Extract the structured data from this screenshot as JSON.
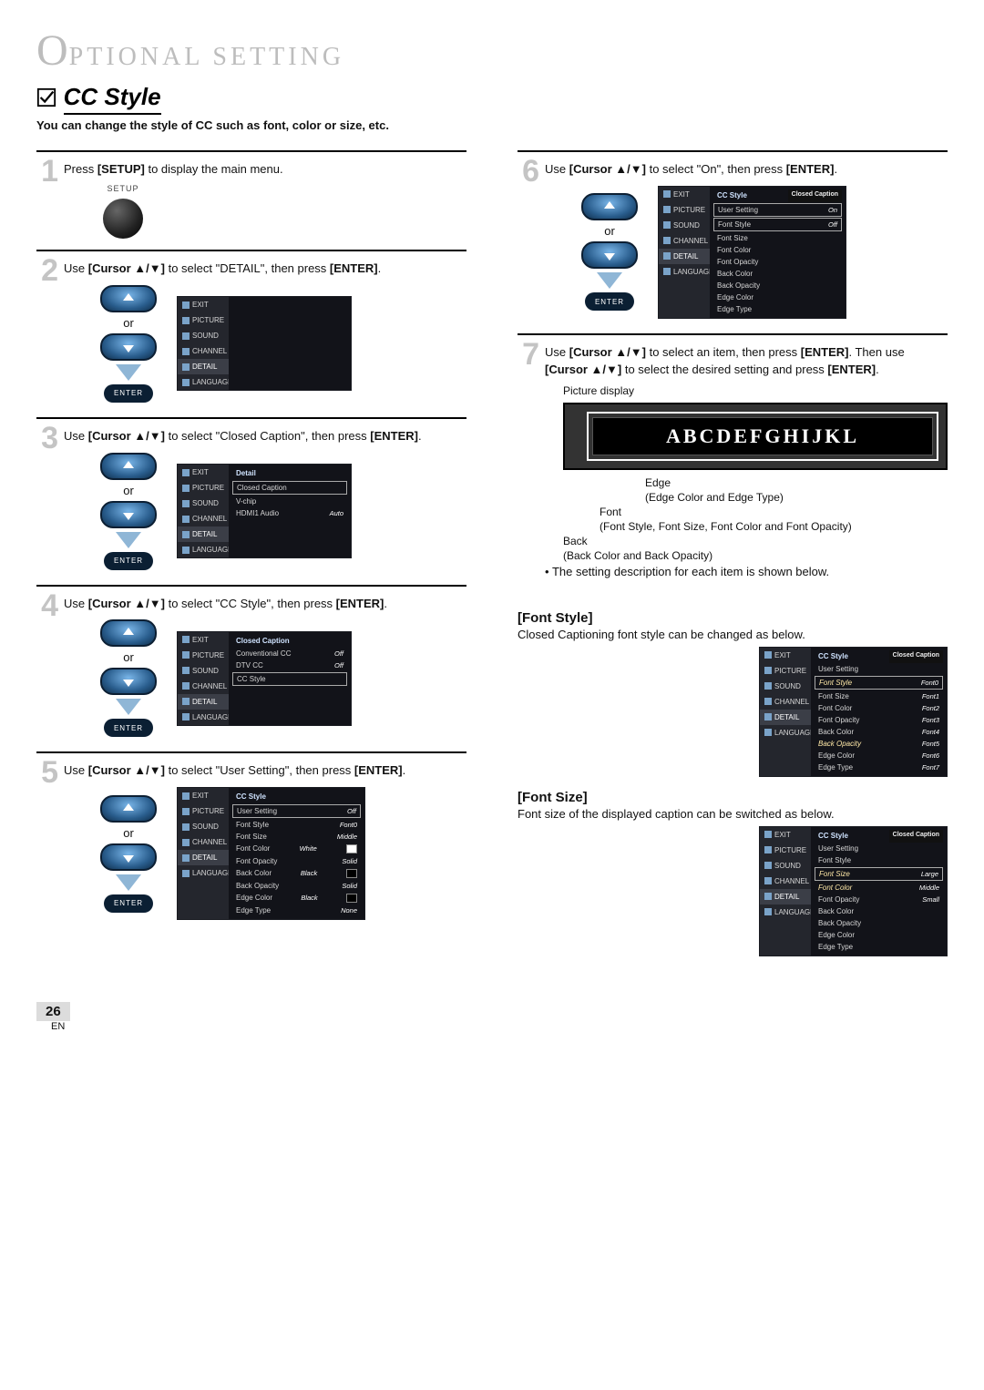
{
  "mast": {
    "o": "O",
    "rest": "PTIONAL  SETTING"
  },
  "section": {
    "title": "CC Style",
    "intro": "You can change the style of CC such as font, color or size, etc."
  },
  "labels": {
    "or": "or",
    "enter": "ENTER",
    "setup": "SETUP",
    "arrows": "▲ / ▼"
  },
  "osdSide": [
    "EXIT",
    "PICTURE",
    "SOUND",
    "CHANNEL",
    "DETAIL",
    "LANGUAGE"
  ],
  "steps": {
    "s1": {
      "n": "1",
      "text_a": "Press ",
      "key": "[SETUP]",
      "text_b": " to display the main menu."
    },
    "s2": {
      "n": "2",
      "text_a": "Use ",
      "key1": "[Cursor ▲/▼]",
      "text_b": " to select \"DETAIL\", then press ",
      "key2": "[ENTER]",
      "text_c": "."
    },
    "s3": {
      "n": "3",
      "text_a": "Use ",
      "key1": "[Cursor ▲/▼]",
      "text_b": " to select \"Closed Caption\", then press ",
      "key2": "[ENTER]",
      "text_c": ".",
      "osd": {
        "title": "Detail",
        "rows": [
          {
            "l": "Closed Caption",
            "boxed": true
          },
          {
            "l": "V-chip"
          },
          {
            "l": "HDMI1 Audio",
            "v": "Auto"
          }
        ]
      }
    },
    "s4": {
      "n": "4",
      "text_a": "Use ",
      "key1": "[Cursor ▲/▼]",
      "text_b": " to select \"CC Style\", then press ",
      "key2": "[ENTER]",
      "text_c": ".",
      "osd": {
        "title": "Closed Caption",
        "rows": [
          {
            "l": "Conventional CC",
            "v": "Off"
          },
          {
            "l": "DTV CC",
            "v": "Off"
          },
          {
            "l": "CC Style",
            "boxed": true
          }
        ]
      }
    },
    "s5": {
      "n": "5",
      "text_a": "Use ",
      "key1": "[Cursor ▲/▼]",
      "text_b": " to select \"User Setting\", then press ",
      "key2": "[ENTER]",
      "text_c": ".",
      "osd": {
        "title": "CC Style",
        "rows": [
          {
            "l": "User Setting",
            "v": "Off",
            "boxed": true
          },
          {
            "l": "Font Style",
            "v": "Font0"
          },
          {
            "l": "Font Size",
            "v": "Middle"
          },
          {
            "l": "Font Color",
            "v": "White",
            "sw": "w"
          },
          {
            "l": "Font Opacity",
            "v": "Solid"
          },
          {
            "l": "Back Color",
            "v": "Black",
            "sw": "b"
          },
          {
            "l": "Back Opacity",
            "v": "Solid"
          },
          {
            "l": "Edge Color",
            "v": "Black",
            "sw": "b"
          },
          {
            "l": "Edge Type",
            "v": "None"
          }
        ]
      }
    },
    "s6": {
      "n": "6",
      "text_a": "Use ",
      "key1": "[Cursor ▲/▼]",
      "text_b": " to select \"On\", then press ",
      "key2": "[ENTER]",
      "text_c": ".",
      "osd": {
        "title": "CC Style",
        "badge": "Closed Caption",
        "rows": [
          {
            "l": "User Setting",
            "v": "On",
            "boxed": true
          },
          {
            "l": "Font Style",
            "v": "Off",
            "boxed": true
          },
          {
            "l": "Font Size"
          },
          {
            "l": "Font Color"
          },
          {
            "l": "Font Opacity"
          },
          {
            "l": "Back Color"
          },
          {
            "l": "Back Opacity"
          },
          {
            "l": "Edge Color"
          },
          {
            "l": "Edge Type"
          }
        ]
      }
    },
    "s7": {
      "n": "7",
      "text_a": "Use ",
      "key1": "[Cursor ▲/▼]",
      "text_b": " to select an item, then press ",
      "key2": "[ENTER]",
      "text_c": ". Then use ",
      "key3": "[Cursor ▲/▼]",
      "text_d": " to select the desired setting and press ",
      "key4": "[ENTER]",
      "text_e": ".",
      "picLabel": "Picture display",
      "picText": "ABCDEFGHIJKL",
      "legend": {
        "edge_t": "Edge",
        "edge_d": "(Edge Color and Edge Type)",
        "font_t": "Font",
        "font_d": "(Font Style, Font Size, Font Color and Font Opacity)",
        "back_t": "Back",
        "back_d": "(Back Color and Back Opacity)"
      },
      "bullet": "The setting description for each item is shown below."
    }
  },
  "fontStyle": {
    "h": "[Font Style]",
    "p": "Closed Captioning font style can be changed as below.",
    "osd": {
      "title": "CC Style",
      "badge": "Closed Caption",
      "rows": [
        {
          "l": "User Setting"
        },
        {
          "l": "Font Style",
          "v": "Font0",
          "boxed": true,
          "hl": true
        },
        {
          "l": "Font Size",
          "v": "Font1"
        },
        {
          "l": "Font Color",
          "v": "Font2"
        },
        {
          "l": "Font Opacity",
          "v": "Font3"
        },
        {
          "l": "Back Color",
          "v": "Font4"
        },
        {
          "l": "Back Opacity",
          "v": "Font5",
          "hl": true
        },
        {
          "l": "Edge Color",
          "v": "Font6"
        },
        {
          "l": "Edge Type",
          "v": "Font7"
        }
      ]
    }
  },
  "fontSize": {
    "h": "[Font Size]",
    "p": "Font size of the displayed caption can be switched as below.",
    "osd": {
      "title": "CC Style",
      "badge": "Closed Caption",
      "rows": [
        {
          "l": "User Setting"
        },
        {
          "l": "Font Style"
        },
        {
          "l": "Font Size",
          "v": "Large",
          "boxed": true,
          "hl": true
        },
        {
          "l": "Font Color",
          "v": "Middle",
          "hl": true
        },
        {
          "l": "Font Opacity",
          "v": "Small"
        },
        {
          "l": "Back Color"
        },
        {
          "l": "Back Opacity"
        },
        {
          "l": "Edge Color"
        },
        {
          "l": "Edge Type"
        }
      ]
    }
  },
  "page": {
    "num": "26",
    "lang": "EN"
  }
}
